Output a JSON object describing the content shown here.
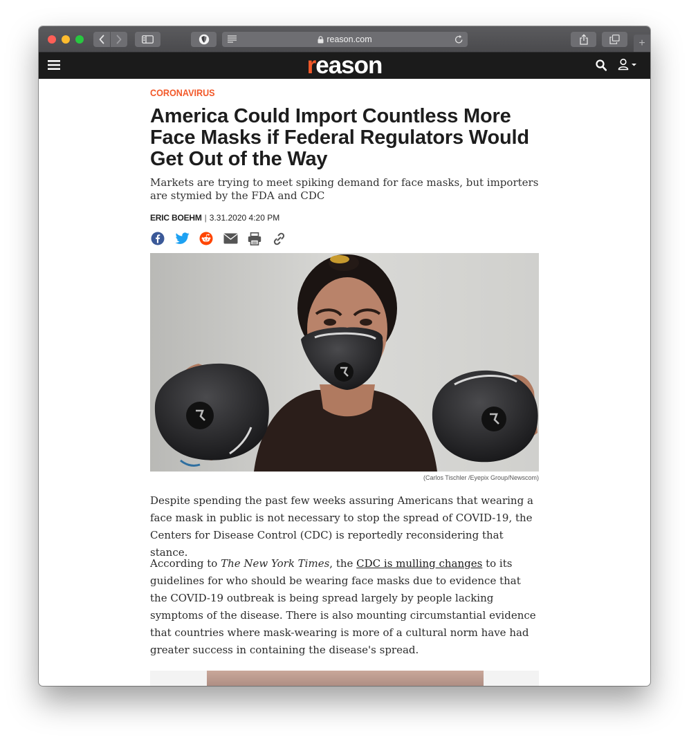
{
  "browser": {
    "url": "reason.com",
    "secure": true
  },
  "site": {
    "logo_accent": "r",
    "logo_rest": "eason",
    "brand_color": "#f2592a"
  },
  "article": {
    "category": "CORONAVIRUS",
    "headline": "America Could Import Countless More Face Masks if Federal Regulators Would Get Out of the Way",
    "subhead": "Markets are trying to meet spiking demand for face masks, but importers are stymied by the FDA and CDC",
    "author": "ERIC BOEHM",
    "byline_separator": "|",
    "date": "3.31.2020 4:20 PM",
    "share_icons": [
      "facebook-icon",
      "twitter-icon",
      "reddit-icon",
      "email-icon",
      "print-icon",
      "link-icon"
    ],
    "image_credit": "(Carlos Tischler /Eyepix Group/Newscom)",
    "paragraph1": "Despite spending the past few weeks assuring Americans that wearing a face mask in public is not necessary to stop the spread of COVID-19, the Centers for Disease Control (CDC) is reportedly reconsidering that stance.",
    "paragraph2": {
      "before": "According to ",
      "publication": "The New York Times",
      "middle": ", the ",
      "link_text": "CDC is mulling changes",
      "after": " to its guidelines for who should be wearing face masks due to evidence that the COVID-19 outbreak is being spread largely by people lacking symptoms of the disease. There is also mounting circumstantial evidence that countries where mask-wearing is more of a cultural norm have had greater success in containing the disease's spread."
    }
  }
}
